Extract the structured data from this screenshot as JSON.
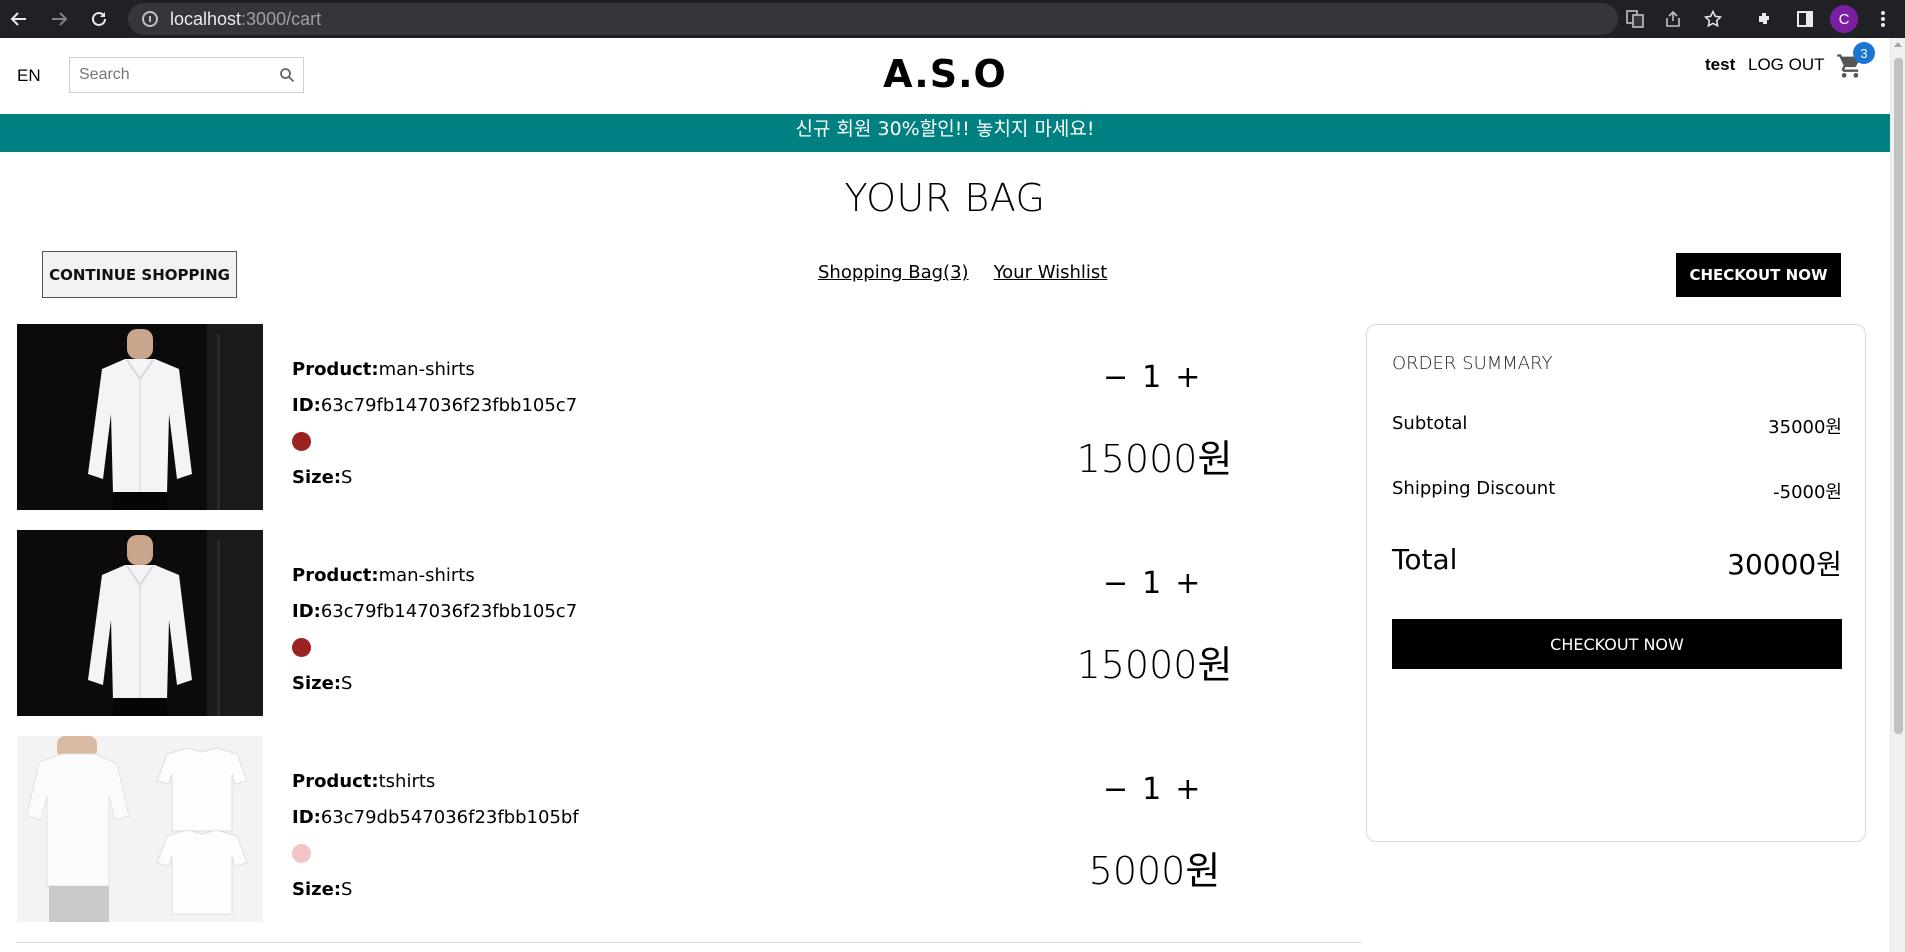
{
  "browser": {
    "url_host": "localhost",
    "url_path": ":3000/cart",
    "profile_initial": "C"
  },
  "header": {
    "language": "EN",
    "search_placeholder": "Search",
    "logo": "A.S.O",
    "username": "test",
    "logout_label": "LOG OUT",
    "cart_count": "3"
  },
  "announcement": "신규 회원 30%할인!! 놓치지 마세요!",
  "page": {
    "title": "YOUR BAG",
    "continue_label": "CONTINUE SHOPPING",
    "shopping_bag_link": "Shopping Bag(3)",
    "wishlist_link": "Your Wishlist",
    "checkout_label": "CHECKOUT NOW"
  },
  "labels": {
    "product": "Product:",
    "id": "ID:",
    "size": "Size:"
  },
  "products": [
    {
      "name": "man-shirts",
      "id": "63c79fb147036f23fbb105c7",
      "color": "#9b2222",
      "size": "S",
      "quantity": "1",
      "price": "15000원",
      "image": "white-dress-shirt"
    },
    {
      "name": "man-shirts",
      "id": "63c79fb147036f23fbb105c7",
      "color": "#9b2222",
      "size": "S",
      "quantity": "1",
      "price": "15000원",
      "image": "white-dress-shirt"
    },
    {
      "name": "tshirts",
      "id": "63c79db547036f23fbb105bf",
      "color": "#f3c4c4",
      "size": "S",
      "quantity": "1",
      "price": "5000원",
      "image": "white-tshirts"
    }
  ],
  "summary": {
    "title": "ORDER SUMMARY",
    "subtotal_label": "Subtotal",
    "subtotal_value": "35000원",
    "shipping_label": "Shipping Discount",
    "shipping_value": "-5000원",
    "total_label": "Total",
    "total_value": "30000원",
    "checkout_label": "CHECKOUT NOW"
  },
  "colors": {
    "announcement_bg": "#008080",
    "badge_bg": "#1976d2",
    "button_bg": "#000000"
  }
}
